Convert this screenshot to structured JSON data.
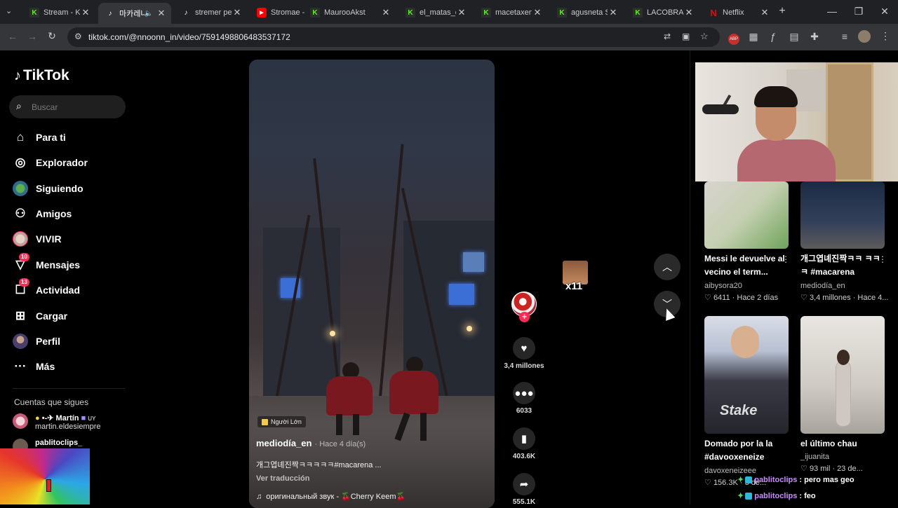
{
  "browser": {
    "tabs": [
      {
        "title": "Stream - Kic",
        "icon": "kick-icon",
        "active": false
      },
      {
        "title": "마카레나",
        "icon": "tiktok-icon",
        "active": true
      },
      {
        "title": "stremer pel",
        "icon": "tiktok-icon",
        "active": false
      },
      {
        "title": "Stromae - F",
        "icon": "youtube-icon",
        "active": false
      },
      {
        "title": "MaurooAkst",
        "icon": "kick-icon",
        "active": false
      },
      {
        "title": "el_matas_ca",
        "icon": "kick-icon",
        "active": false
      },
      {
        "title": "macetaxene",
        "icon": "kick-icon",
        "active": false
      },
      {
        "title": "agusneta St",
        "icon": "kick-icon",
        "active": false
      },
      {
        "title": "LACOBRAA",
        "icon": "kick-icon",
        "active": false
      },
      {
        "title": "Netflix",
        "icon": "netflix-icon",
        "active": false
      }
    ],
    "new_tab": "+",
    "url": "tiktok.com/@nnoonn_in/video/7591498806483537172",
    "icons": {
      "back": "←",
      "forward": "→",
      "reload": "↻",
      "minimize": "—",
      "maximize": "❐",
      "close": "✕"
    }
  },
  "tiktok": {
    "logo_text": "TikTok",
    "search_placeholder": "Buscar",
    "nav": [
      {
        "label": "Para ti",
        "icon": "home-icon"
      },
      {
        "label": "Explorador",
        "icon": "compass-icon"
      },
      {
        "label": "Siguiendo",
        "icon": "following-avatar-icon"
      },
      {
        "label": "Amigos",
        "icon": "friends-icon"
      },
      {
        "label": "VIVIR",
        "icon": "live-avatar-icon"
      },
      {
        "label": "Mensajes",
        "icon": "message-icon",
        "badge": "10"
      },
      {
        "label": "Actividad",
        "icon": "activity-icon",
        "badge": "13"
      },
      {
        "label": "Cargar",
        "icon": "upload-icon"
      },
      {
        "label": "Perfil",
        "icon": "profile-avatar-icon"
      },
      {
        "label": "Más",
        "icon": "more-icon"
      }
    ],
    "following_title": "Cuentas que sigues",
    "following": [
      {
        "display": "Martín",
        "prefix": "•-✈",
        "suffix": "UY",
        "handle": "martin.eldesiempre"
      },
      {
        "display": "pablitoclips_",
        "handle": ""
      }
    ]
  },
  "video": {
    "tag": "Người Lớn",
    "author": "mediodía_en",
    "time": "· Hace 4 día(s)",
    "caption": "개그엽녜진짝ㅋㅋㅋㅋㅋ#macarena ...",
    "translate": "Ver traducción",
    "sound": "оригинальный звук - 🍒Cherry Keem🍒"
  },
  "actions": {
    "likes": "3,4 millones",
    "comments": "6033",
    "saves": "403.6K",
    "shares": "555.1K"
  },
  "emote_count": "x11",
  "recommendations": [
    {
      "title": "Messi le devuelve al vecino el term...",
      "author": "aibysora20",
      "likes": "6411",
      "time": "· Hace 2 días"
    },
    {
      "title": "개그엽녜진짝ㅋㅋ ㅋㅋㅋ #macarena",
      "author": "mediodía_en",
      "likes": "3,4 millones",
      "time": "· Hace 4..."
    },
    {
      "title": "Domado por la la #davooxeneize",
      "author": "davoxeneizeee",
      "likes": "156.3K",
      "time": "· 3 de..."
    },
    {
      "title": "el último chau",
      "author": "_ijuanita",
      "likes": "93 mil",
      "time": "· 23 de..."
    }
  ],
  "chat": [
    {
      "name": "pablitoclips",
      "message": ": pero mas geo"
    },
    {
      "name": "pablitoclips",
      "message": ": feo"
    }
  ],
  "colors": {
    "accent": "#fe2c55",
    "kick": "#53fc18",
    "chat_name": "#c88bff"
  }
}
